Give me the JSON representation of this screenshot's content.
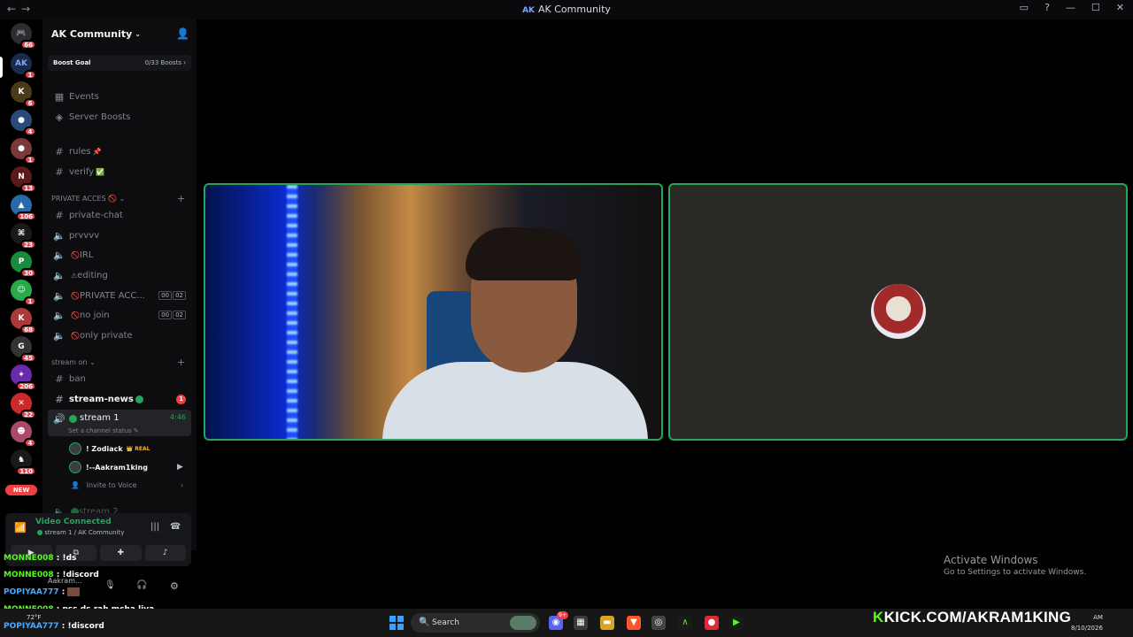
{
  "window": {
    "title": "AK Community",
    "title_logo": "AK"
  },
  "rail": {
    "servers": [
      {
        "badge": "66"
      },
      {
        "badge": "1"
      },
      {
        "badge": "6"
      },
      {
        "badge": "4"
      },
      {
        "badge": "1"
      },
      {
        "badge": "13"
      },
      {
        "badge": "106"
      },
      {
        "badge": "23"
      },
      {
        "badge": "30"
      },
      {
        "badge": "1"
      },
      {
        "badge": "68"
      },
      {
        "badge": "45"
      },
      {
        "badge": "206"
      },
      {
        "badge": "22"
      },
      {
        "badge": "4"
      },
      {
        "badge": "110"
      },
      {
        "badge": "NEW"
      }
    ]
  },
  "sidebar": {
    "server_name": "AK Community",
    "boost_goal_label": "Boost Goal",
    "boost_count": "0/33 Boosts",
    "events": "Events",
    "server_boosts": "Server Boosts",
    "text_channels": [
      {
        "name": "rules",
        "emoji": "📌"
      },
      {
        "name": "verify",
        "emoji": "✅"
      }
    ],
    "category_private": "PRIVATE ACCES",
    "private_channels": [
      {
        "name": "private-chat"
      },
      {
        "name": "prvvvv"
      },
      {
        "name": "IRL"
      },
      {
        "name": "editing"
      },
      {
        "name": "PRIVATE ACC...",
        "c1": "00",
        "c2": "02"
      },
      {
        "name": "no join",
        "c1": "00",
        "c2": "02"
      },
      {
        "name": "only private"
      }
    ],
    "category_stream": "stream on",
    "stream_channels": [
      {
        "name": "ban"
      },
      {
        "name": "stream-news",
        "badge": "1"
      },
      {
        "name": "stream 1",
        "time": "4:46",
        "status": "Set a channel status"
      }
    ],
    "members": [
      {
        "name": "! Zodiack",
        "tag": "REAL"
      },
      {
        "name": "!--Aakram1king"
      }
    ],
    "invite": "Invite to Voice",
    "next_channel": "stream 2"
  },
  "voice": {
    "status": "Video Connected",
    "location": "stream 1 / AK Community"
  },
  "watermark": {
    "line1": "Activate Windows",
    "line2": "Go to Settings to activate Windows."
  },
  "chat": [
    {
      "user": "MONNE008",
      "msg": " : !ds"
    },
    {
      "user": "MONNE008",
      "msg": " : !discord"
    },
    {
      "user": "POPIYAA777",
      "msg": " : "
    },
    {
      "user": "MONNE008",
      "msg": " : pss ds rah mcha liya"
    },
    {
      "user": "POPIYAA777",
      "msg": " : !discord"
    }
  ],
  "user_footer": {
    "name": "Aakram..."
  },
  "taskbar": {
    "search": "Search",
    "weather": "72°F",
    "kick_text": "KICK.COM/AKRAM1KING",
    "time": "AM",
    "date": "8/10/2026",
    "notif_badge": "9+"
  },
  "colors": {
    "accent_green": "#23a55a",
    "kick_green": "#53fc18",
    "danger": "#f23f43"
  }
}
